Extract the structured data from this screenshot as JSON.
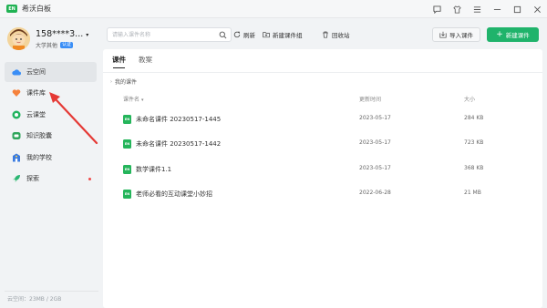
{
  "app": {
    "title": "希沃白板",
    "logo_text": "EN"
  },
  "titlebar_icons": [
    "chat-icon",
    "shirt-icon",
    "menu-icon",
    "minimize-icon",
    "restore-icon",
    "close-icon"
  ],
  "user": {
    "name": "158****3...",
    "role": "大学其他",
    "badge": "认证"
  },
  "sidebar": {
    "items": [
      {
        "label": "云空间",
        "icon": "cloud-icon",
        "active": true
      },
      {
        "label": "课件库",
        "icon": "heart-icon",
        "active": false
      },
      {
        "label": "云课堂",
        "icon": "circle-play-icon",
        "active": false
      },
      {
        "label": "知识胶囊",
        "icon": "capsule-icon",
        "active": false
      },
      {
        "label": "我的学校",
        "icon": "school-icon",
        "active": false
      },
      {
        "label": "探索",
        "icon": "rocket-icon",
        "active": false,
        "dot": true
      }
    ],
    "storage": "云空间：23MB / 2GB"
  },
  "toolbar": {
    "search_placeholder": "请输入课件名称",
    "refresh_label": "刷新",
    "new_group_label": "新建课件组",
    "recycle_label": "回收站",
    "import_label": "导入课件",
    "new_label": "新建课件"
  },
  "main": {
    "tabs": [
      {
        "label": "课件",
        "active": true
      },
      {
        "label": "教案",
        "active": false
      }
    ],
    "breadcrumb": "我的课件",
    "columns": {
      "name": "课件名",
      "updated": "更新时间",
      "size": "大小"
    },
    "rows": [
      {
        "name": "未命名课件 20230517-1445",
        "updated": "2023-05-17",
        "size": "284 KB",
        "icon_text": "EN"
      },
      {
        "name": "未命名课件 20230517-1442",
        "updated": "2023-05-17",
        "size": "723 KB",
        "icon_text": "EN"
      },
      {
        "name": "数学课件1.1",
        "updated": "2023-05-17",
        "size": "368 KB",
        "icon_text": "EN"
      },
      {
        "name": "老师必看的互动课堂小妙招",
        "updated": "2022-06-28",
        "size": "21 MB",
        "icon_text": "EN"
      }
    ]
  },
  "colors": {
    "brand_green": "#1fb36b",
    "arrow_red": "#e53935",
    "active_bg": "#e3e6e9"
  }
}
